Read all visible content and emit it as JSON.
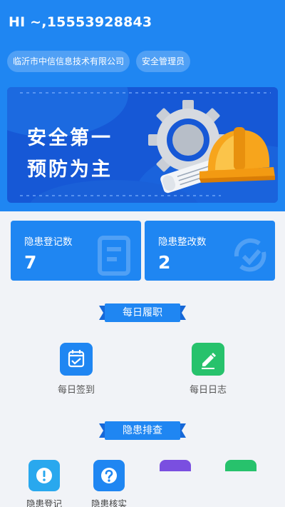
{
  "header": {
    "greeting": "HI ~,15553928843",
    "company": "临沂市中信信息技术有限公司",
    "role": "安全管理员",
    "bg_color": "#1f86f2"
  },
  "banner": {
    "line1": "安全第一",
    "line2": "预防为主",
    "illustration": "gear-helmet-blueprint"
  },
  "stats": [
    {
      "label": "隐患登记数",
      "value": "7",
      "icon": "form-icon"
    },
    {
      "label": "隐患整改数",
      "value": "2",
      "icon": "refresh-check-icon"
    }
  ],
  "daily": {
    "title": "每日履职",
    "items": [
      {
        "label": "每日签到",
        "icon": "calendar-check-icon",
        "color": "#1f86f2"
      },
      {
        "label": "每日日志",
        "icon": "pencil-icon",
        "color": "#27c26c"
      }
    ]
  },
  "hazard": {
    "title": "隐患排查",
    "items": [
      {
        "label": "隐患登记",
        "icon": "exclamation-icon",
        "color": "#29a8ee"
      },
      {
        "label": "隐患核实",
        "icon": "question-icon",
        "color": "#1f86f2"
      },
      {
        "label": "",
        "icon": "app-icon",
        "color": "#7a4fe0"
      },
      {
        "label": "",
        "icon": "app-icon",
        "color": "#27c26c"
      }
    ]
  }
}
